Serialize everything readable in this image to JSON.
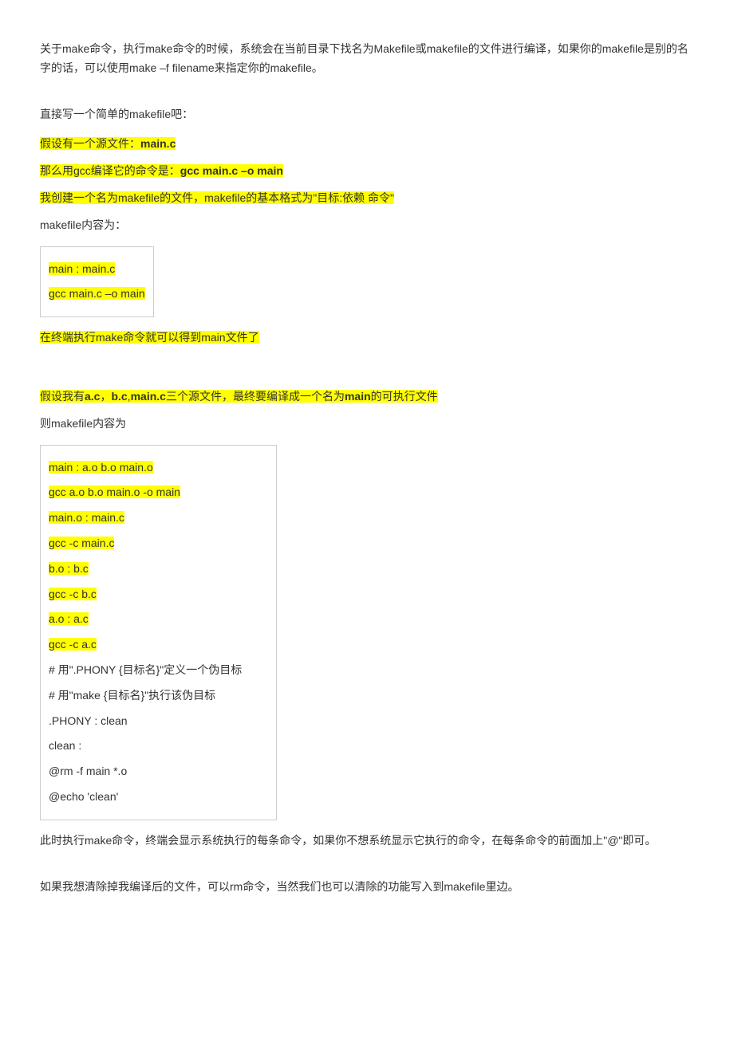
{
  "intro": "关于make命令，执行make命令的时候，系统会在当前目录下找名为Makefile或makefile的文件进行编译，如果你的makefile是别的名字的话，可以使用make –f filename来指定你的makefile。",
  "section1": {
    "lead": "直接写一个简单的makefile吧：",
    "line1_pre": "假设有一个源文件：",
    "line1_bold": "main.c",
    "line2_pre": "那么用gcc编译它的命令是：",
    "line2_bold": "gcc main.c –o main",
    "line3": "我创建一个名为makefile的文件，makefile的基本格式为\"目标:依赖 命令\"",
    "content_label": "makefile内容为：",
    "code": {
      "r1": "main : main.c",
      "r2": "gcc main.c –o main"
    },
    "after": "在终端执行make命令就可以得到main文件了"
  },
  "section2": {
    "lead_pre": "假设我有",
    "lead_b1": "a.c",
    "lead_s1": "，",
    "lead_b2": "b.c",
    "lead_s2": ",",
    "lead_b3": "main.c",
    "lead_mid": "三个源文件，最终要编译成一个名为",
    "lead_b4": "main",
    "lead_post": "的可执行文件",
    "content_label": "则makefile内容为",
    "code": {
      "r1": "main : a.o b.o main.o",
      "r2": "gcc a.o b.o main.o -o main",
      "r3": "main.o : main.c",
      "r4": "gcc -c main.c",
      "r5": "b.o : b.c",
      "r6": "gcc -c b.c",
      "r7": "a.o : a.c",
      "r8": "gcc -c a.c",
      "r9": "# 用\".PHONY {目标名}\"定义一个伪目标",
      "r10": "# 用\"make {目标名}\"执行该伪目标",
      "r11": ".PHONY : clean",
      "r12": "clean :",
      "r13": "@rm -f main *.o",
      "r14": "@echo 'clean'"
    }
  },
  "para_after_code": "此时执行make命令，终端会显示系统执行的每条命令，如果你不想系统显示它执行的命令，在每条命令的前面加上\"@\"即可。",
  "para_last": "如果我想清除掉我编译后的文件，可以rm命令，当然我们也可以清除的功能写入到makefile里边。"
}
